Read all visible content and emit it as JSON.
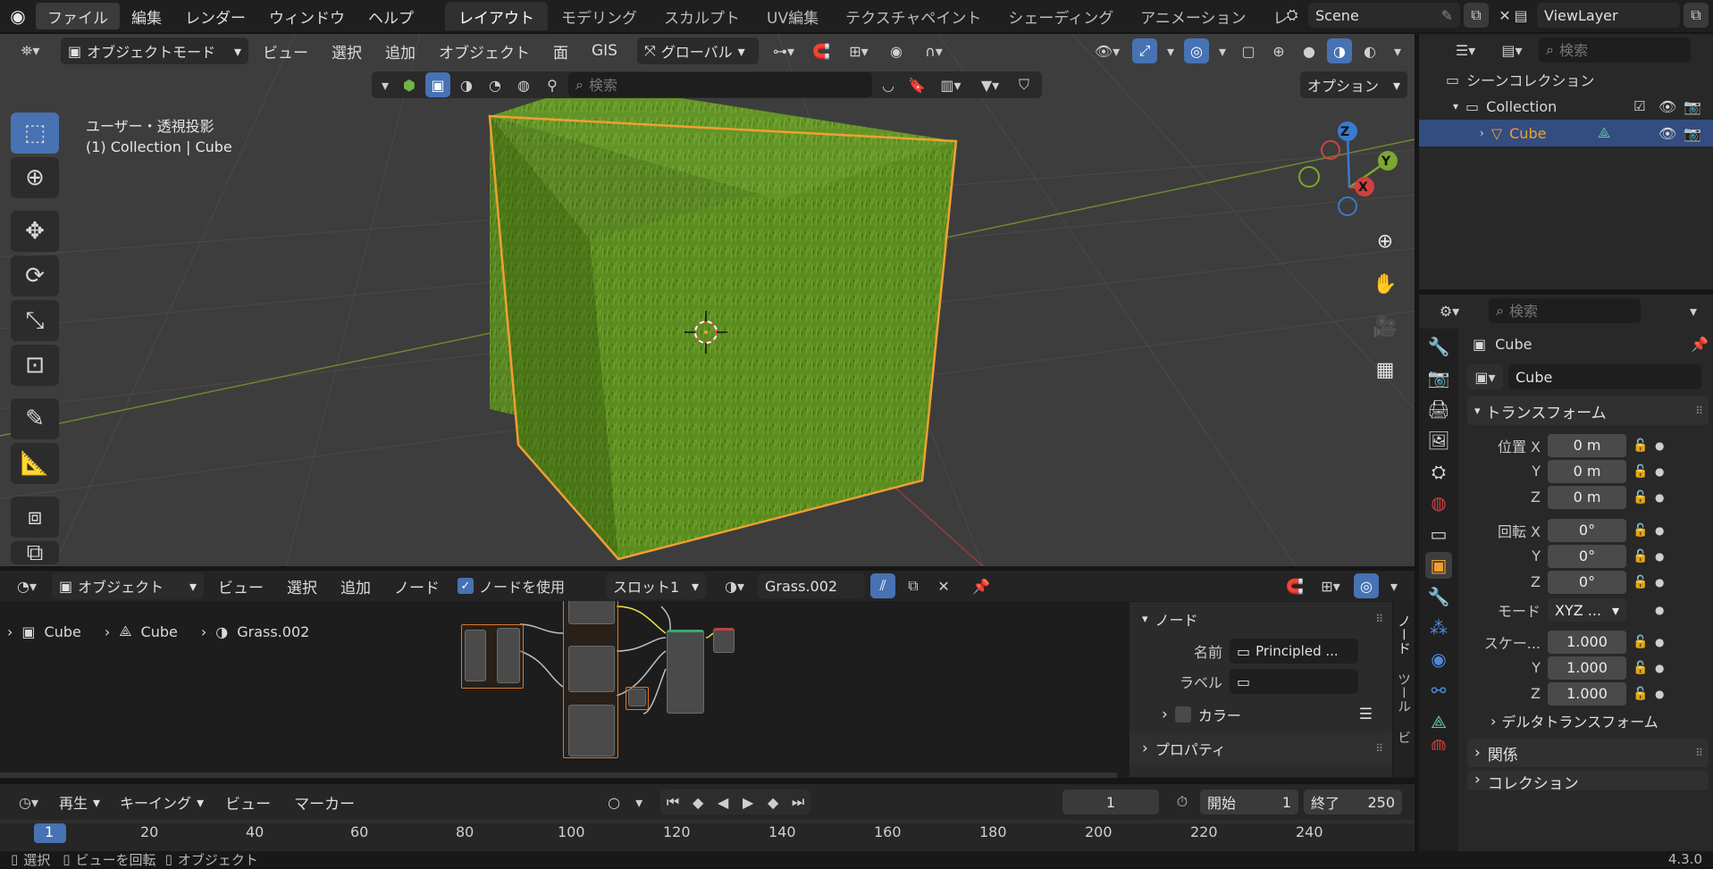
{
  "topbar": {
    "menus": [
      "ファイル",
      "編集",
      "レンダー",
      "ウィンドウ",
      "ヘルプ"
    ],
    "workspaces": [
      "レイアウト",
      "モデリング",
      "スカルプト",
      "UV編集",
      "テクスチャペイント",
      "シェーディング",
      "アニメーション",
      "レ"
    ],
    "scene_label": "Scene",
    "viewlayer_label": "ViewLayer"
  },
  "viewport": {
    "mode": "オブジェクトモード",
    "menus": [
      "ビュー",
      "選択",
      "追加",
      "オブジェクト",
      "面",
      "GIS"
    ],
    "transform_orientation": "グローバル",
    "search_placeholder": "検索",
    "options_label": "オプション",
    "overlay_title": "ユーザー・透視投影",
    "overlay_subtitle": "(1) Collection | Cube",
    "gizmo": {
      "x": "X",
      "y": "Y",
      "z": "Z"
    }
  },
  "outliner": {
    "search_placeholder": "検索",
    "scene_collection": "シーンコレクション",
    "collection": "Collection",
    "object": "Cube"
  },
  "properties": {
    "search_placeholder": "検索",
    "object_title": "Cube",
    "object_name": "Cube",
    "transform_label": "トランスフォーム",
    "location_label": "位置 X",
    "rotation_label": "回転 X",
    "mode_label": "モード",
    "mode_value": "XYZ ...",
    "scale_label": "スケー...",
    "axis_y": "Y",
    "axis_z": "Z",
    "location": [
      "0 m",
      "0 m",
      "0 m"
    ],
    "rotation": [
      "0°",
      "0°",
      "0°"
    ],
    "scale": [
      "1.000",
      "1.000",
      "1.000"
    ],
    "delta_transform": "デルタトランスフォーム",
    "relations": "関係",
    "collections": "コレクション",
    "version": "4.3.0"
  },
  "node_editor": {
    "mode": "オブジェクト",
    "menus": [
      "ビュー",
      "選択",
      "追加",
      "ノード"
    ],
    "use_nodes_label": "ノードを使用",
    "slot": "スロット1",
    "material": "Grass.002",
    "breadcrumb": [
      "Cube",
      "Cube",
      "Grass.002"
    ],
    "panel": {
      "node_section": "ノード",
      "name_label": "名前",
      "name_value": "Principled ...",
      "label_label": "ラベル",
      "color_label": "カラー",
      "properties_label": "プロパティ",
      "tab_node": "ノード",
      "tab_tool": "ツール",
      "tab_view": "ビ"
    }
  },
  "timeline": {
    "play": "再生",
    "keying": "キーイング",
    "view": "ビュー",
    "marker": "マーカー",
    "current_frame": "1",
    "start_label": "開始",
    "start_value": "1",
    "end_label": "終了",
    "end_value": "250",
    "ticks": [
      "1",
      "20",
      "40",
      "60",
      "80",
      "100",
      "120",
      "140",
      "160",
      "180",
      "200",
      "220",
      "240"
    ]
  },
  "statusbar": {
    "select": "選択",
    "rotate": "ビューを回転",
    "object": "オブジェクト"
  },
  "colors": {
    "accent": "#4772b3",
    "selection_orange": "#f0a030",
    "grass_green": "#5a8a1e"
  }
}
